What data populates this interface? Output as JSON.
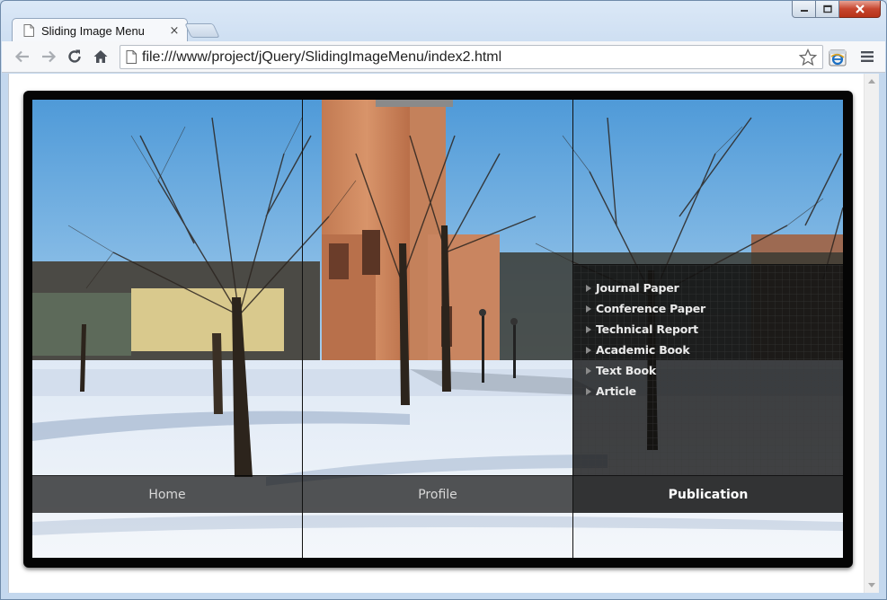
{
  "browser": {
    "tab_title": "Sliding Image Menu",
    "tab_close": "×",
    "url": "file:///www/project/jQuery/SlidingImageMenu/index2.html"
  },
  "menu": {
    "items": [
      {
        "label": "Home"
      },
      {
        "label": "Profile"
      },
      {
        "label": "Publication"
      }
    ],
    "active_index": 2,
    "submenu": [
      "Journal Paper",
      "Conference Paper",
      "Technical Report",
      "Academic Book",
      "Text Book",
      "Article"
    ]
  },
  "colors": {
    "frame": "#050505",
    "label_text": "#d8d8d8",
    "active_label_text": "#ffffff",
    "submenu_text": "#eaeaea"
  }
}
